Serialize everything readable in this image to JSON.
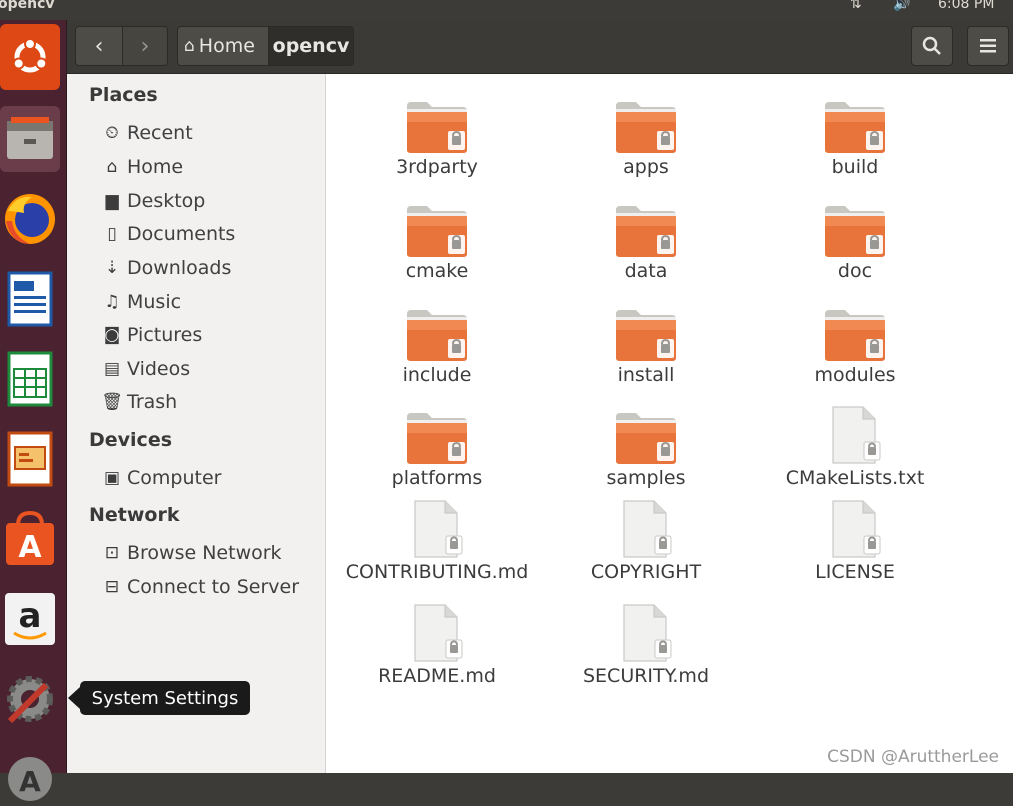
{
  "window_title": "opencv",
  "clock": "6:08 PM",
  "colors": {
    "launcher_bg": "#4a2230",
    "accent": "#e95420",
    "folder": "#e8743b"
  },
  "header": {
    "back_icon": "chevron-left-icon",
    "forward_icon": "chevron-right-icon",
    "path": [
      {
        "label": "Home",
        "icon": "home-icon"
      },
      {
        "label": "opencv"
      }
    ],
    "search_icon": "search-icon",
    "menu_icon": "hamburger-menu-icon"
  },
  "launcher": {
    "items": [
      {
        "name": "ubuntu-dash-icon"
      },
      {
        "name": "files-icon"
      },
      {
        "name": "firefox-icon"
      },
      {
        "name": "libreoffice-writer-icon"
      },
      {
        "name": "libreoffice-calc-icon"
      },
      {
        "name": "libreoffice-impress-icon"
      },
      {
        "name": "ubuntu-software-icon"
      },
      {
        "name": "amazon-icon"
      },
      {
        "name": "system-settings-icon"
      },
      {
        "name": "software-updater-icon"
      }
    ],
    "tooltip": "System Settings"
  },
  "sidebar": {
    "places_header": "Places",
    "places": [
      {
        "label": "Recent",
        "icon": "clock-icon"
      },
      {
        "label": "Home",
        "icon": "home-icon"
      },
      {
        "label": "Desktop",
        "icon": "folder-icon"
      },
      {
        "label": "Documents",
        "icon": "document-icon"
      },
      {
        "label": "Downloads",
        "icon": "download-icon"
      },
      {
        "label": "Music",
        "icon": "music-icon"
      },
      {
        "label": "Pictures",
        "icon": "camera-icon"
      },
      {
        "label": "Videos",
        "icon": "film-icon"
      },
      {
        "label": "Trash",
        "icon": "trash-icon"
      }
    ],
    "devices_header": "Devices",
    "devices": [
      {
        "label": "Computer",
        "icon": "drive-icon"
      }
    ],
    "network_header": "Network",
    "network": [
      {
        "label": "Browse Network",
        "icon": "network-icon"
      },
      {
        "label": "Connect to Server",
        "icon": "server-icon"
      }
    ]
  },
  "files": [
    {
      "name": "3rdparty",
      "type": "folder"
    },
    {
      "name": "apps",
      "type": "folder"
    },
    {
      "name": "build",
      "type": "folder"
    },
    {
      "name": "cmake",
      "type": "folder"
    },
    {
      "name": "data",
      "type": "folder"
    },
    {
      "name": "doc",
      "type": "folder"
    },
    {
      "name": "include",
      "type": "folder"
    },
    {
      "name": "install",
      "type": "folder"
    },
    {
      "name": "modules",
      "type": "folder"
    },
    {
      "name": "platforms",
      "type": "folder"
    },
    {
      "name": "samples",
      "type": "folder"
    },
    {
      "name": "CMakeLists.txt",
      "type": "file"
    },
    {
      "name": "CONTRIBUTING.md",
      "type": "file"
    },
    {
      "name": "COPYRIGHT",
      "type": "file"
    },
    {
      "name": "LICENSE",
      "type": "file"
    },
    {
      "name": "README.md",
      "type": "file"
    },
    {
      "name": "SECURITY.md",
      "type": "file"
    }
  ],
  "watermark": "CSDN @AruttherLee"
}
